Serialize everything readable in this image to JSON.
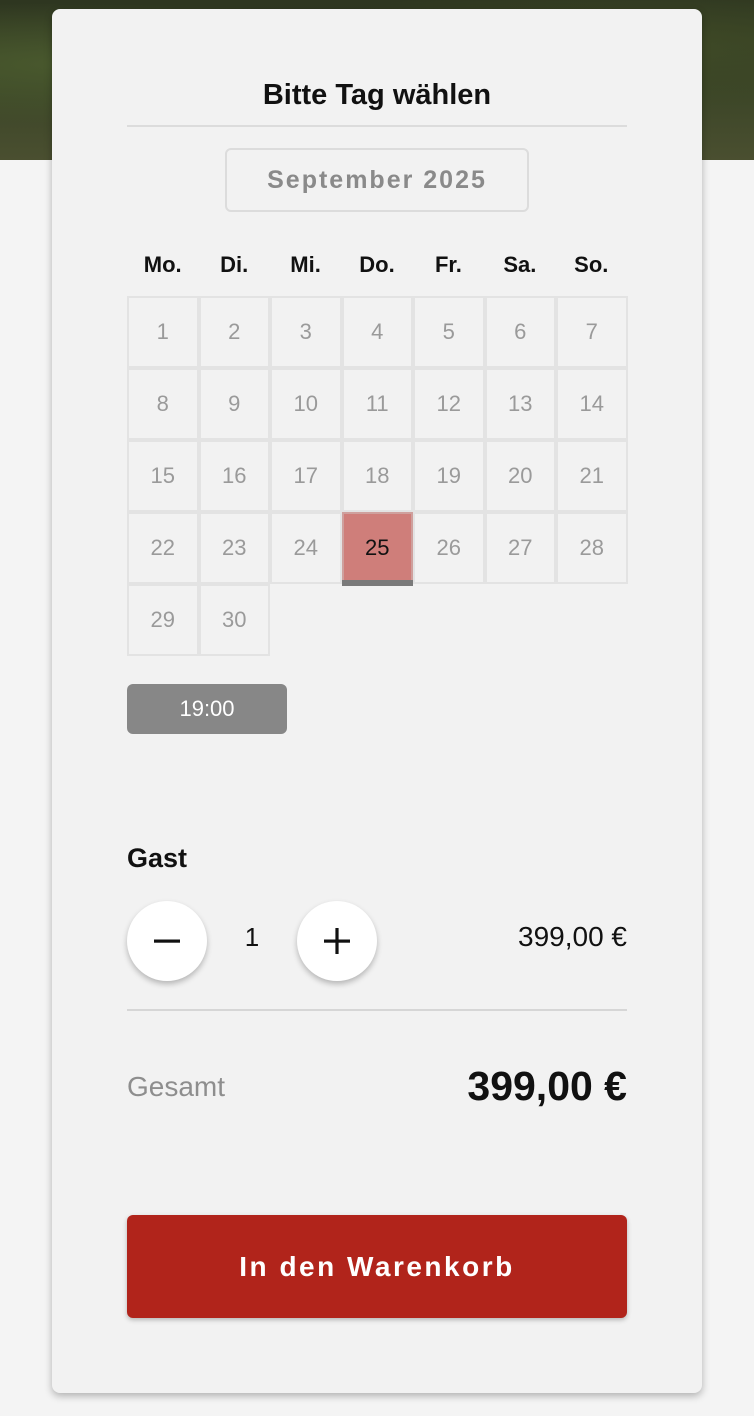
{
  "card": {
    "title": "Bitte Tag wählen"
  },
  "calendar": {
    "month_label": "September 2025",
    "weekdays": [
      "Mo.",
      "Di.",
      "Mi.",
      "Do.",
      "Fr.",
      "Sa.",
      "So."
    ],
    "days": [
      "1",
      "2",
      "3",
      "4",
      "5",
      "6",
      "7",
      "8",
      "9",
      "10",
      "11",
      "12",
      "13",
      "14",
      "15",
      "16",
      "17",
      "18",
      "19",
      "20",
      "21",
      "22",
      "23",
      "24",
      "25",
      "26",
      "27",
      "28",
      "29",
      "30"
    ],
    "selected_day": "25",
    "selected_color": "#cf7e7a"
  },
  "time_slots": [
    "19:00"
  ],
  "guests": {
    "label": "Gast",
    "quantity": "1",
    "unit_price": "399,00 €",
    "minus_icon": "minus-icon",
    "plus_icon": "plus-icon"
  },
  "total": {
    "label": "Gesamt",
    "value": "399,00 €"
  },
  "cart_button": {
    "label": "In den Warenkorb",
    "color": "#b1241b"
  }
}
